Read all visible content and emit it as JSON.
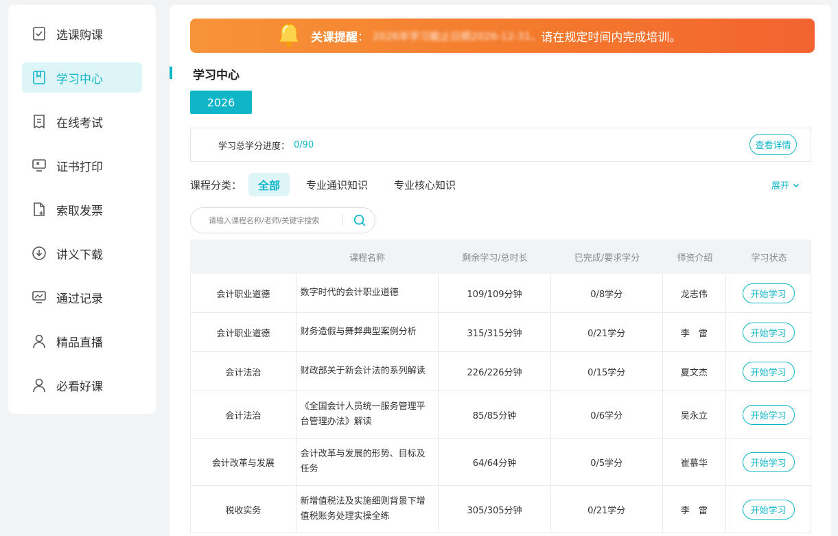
{
  "sidebar": {
    "items": [
      {
        "label": "选课购课",
        "icon": "checkbox-icon"
      },
      {
        "label": "学习中心",
        "icon": "book-icon",
        "active": true
      },
      {
        "label": "在线考试",
        "icon": "exam-icon"
      },
      {
        "label": "证书打印",
        "icon": "monitor-icon"
      },
      {
        "label": "索取发票",
        "icon": "invoice-icon"
      },
      {
        "label": "讲义下载",
        "icon": "download-icon"
      },
      {
        "label": "通过记录",
        "icon": "chart-icon"
      },
      {
        "label": "精品直播",
        "icon": "user-icon"
      },
      {
        "label": "必看好课",
        "icon": "user-icon"
      }
    ]
  },
  "notice": {
    "title": "关课提醒",
    "colon": "：",
    "blurred": "2026年学习截止日期2026-12-31，",
    "text": "请在规定时间内完成培训。"
  },
  "section": {
    "title": "学习中心"
  },
  "year_tab": "2026",
  "progress": {
    "label": "学习总学分进度：",
    "value": "0/90",
    "detail_button": "查看详情"
  },
  "category": {
    "label": "课程分类：",
    "options": [
      "全部",
      "专业通识知识",
      "专业核心知识"
    ],
    "active": 0,
    "expand": "展开"
  },
  "search": {
    "placeholder": "请输入课程名称/老师/关键字搜索"
  },
  "table": {
    "headers": [
      "",
      "课程名称",
      "剩余学习/总时长",
      "已完成/要求学分",
      "师资介绍",
      "学习状态"
    ],
    "action_label": "开始学习",
    "rows": [
      {
        "category": "会计职业道德",
        "name": "数字时代的会计职业道德",
        "time": "109/109分钟",
        "credit": "0/8学分",
        "teacher": "龙志伟"
      },
      {
        "category": "会计职业道德",
        "name": "财务造假与舞弊典型案例分析",
        "time": "315/315分钟",
        "credit": "0/21学分",
        "teacher": "李　雷"
      },
      {
        "category": "会计法治",
        "name": "财政部关于新会计法的系列解读",
        "time": "226/226分钟",
        "credit": "0/15学分",
        "teacher": "夏文杰"
      },
      {
        "category": "会计法治",
        "name": "《全国会计人员统一服务管理平台管理办法》解读",
        "time": "85/85分钟",
        "credit": "0/6学分",
        "teacher": "吴永立"
      },
      {
        "category": "会计改革与发展",
        "name": "会计改革与发展的形势、目标及任务",
        "time": "64/64分钟",
        "credit": "0/5学分",
        "teacher": "崔慕华"
      },
      {
        "category": "税收实务",
        "name": "新增值税法及实施细则背景下增值税账务处理实操全练",
        "time": "305/305分钟",
        "credit": "0/21学分",
        "teacher": "李　雷"
      }
    ]
  },
  "colors": {
    "accent": "#10b6c8",
    "notice_start": "#f7943a",
    "notice_end": "#f26330"
  }
}
